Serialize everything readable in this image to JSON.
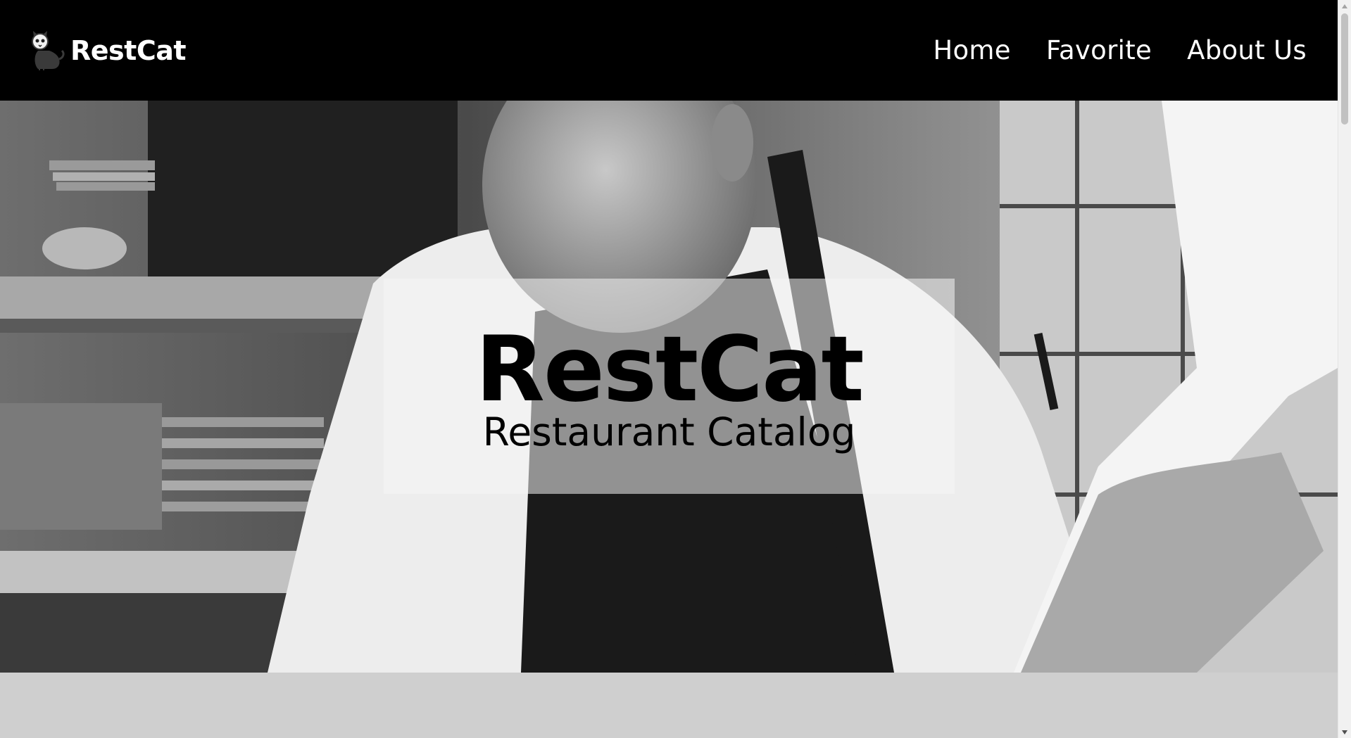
{
  "header": {
    "brand_name": "RestCat",
    "logo_icon": "cat-icon",
    "nav": [
      {
        "label": "Home"
      },
      {
        "label": "Favorite"
      },
      {
        "label": "About Us"
      }
    ]
  },
  "hero": {
    "title": "RestCat",
    "subtitle": "Restaurant Catalog",
    "photo": "chef-cooking-black-and-white-photo"
  },
  "colors": {
    "header_bg": "#000000",
    "nav_text": "#ffffff",
    "overlay": "rgba(245,245,245,0.55)",
    "page_bg": "#cfcfcf"
  }
}
